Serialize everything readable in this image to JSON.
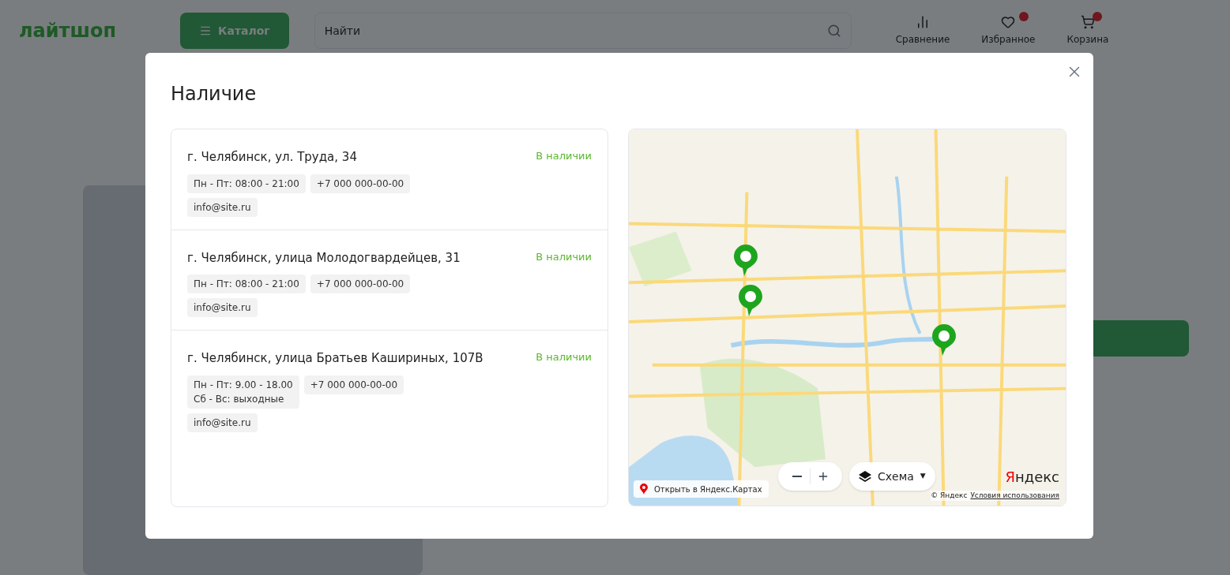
{
  "backdrop": {
    "logo": "лайтшоп",
    "catalog_button": "Каталог",
    "search": {
      "placeholder": "Найти"
    },
    "header_actions": [
      {
        "label": "Сравнение",
        "badge": false
      },
      {
        "label": "Избранное",
        "badge": true
      },
      {
        "label": "Корзина",
        "badge": true
      }
    ]
  },
  "modal": {
    "title": "Наличие",
    "stores": [
      {
        "address": "г. Челябинск, ул. Труда, 34",
        "available": true,
        "status": "В наличии",
        "hours": [
          "Пн - Пт: 08:00 - 21:00"
        ],
        "phone": "+7 000 000-00-00",
        "email": "info@site.ru"
      },
      {
        "address": "г. Челябинск, улица Молодогвардейцев, 31",
        "available": true,
        "status": "В наличии",
        "hours": [
          "Пн - Пт: 08:00 - 21:00"
        ],
        "phone": "+7 000 000-00-00",
        "email": "info@site.ru"
      },
      {
        "address": "г. Челябинск, улица Братьев Кашириных, 107В",
        "available": true,
        "status": "В наличии",
        "hours": [
          "Пн - Пт: 9.00 - 18.00",
          "Сб - Вс: выходные"
        ],
        "phone": "+7 000 000-00-00",
        "email": "info@site.ru"
      }
    ],
    "map": {
      "open_link": "Открыть в Яндекс.Картах",
      "layer_button": "Схема",
      "layer_caret": "▼",
      "logo": "Яндекс",
      "copyright": "© Яндекс",
      "terms_link": "Условия использования"
    }
  }
}
